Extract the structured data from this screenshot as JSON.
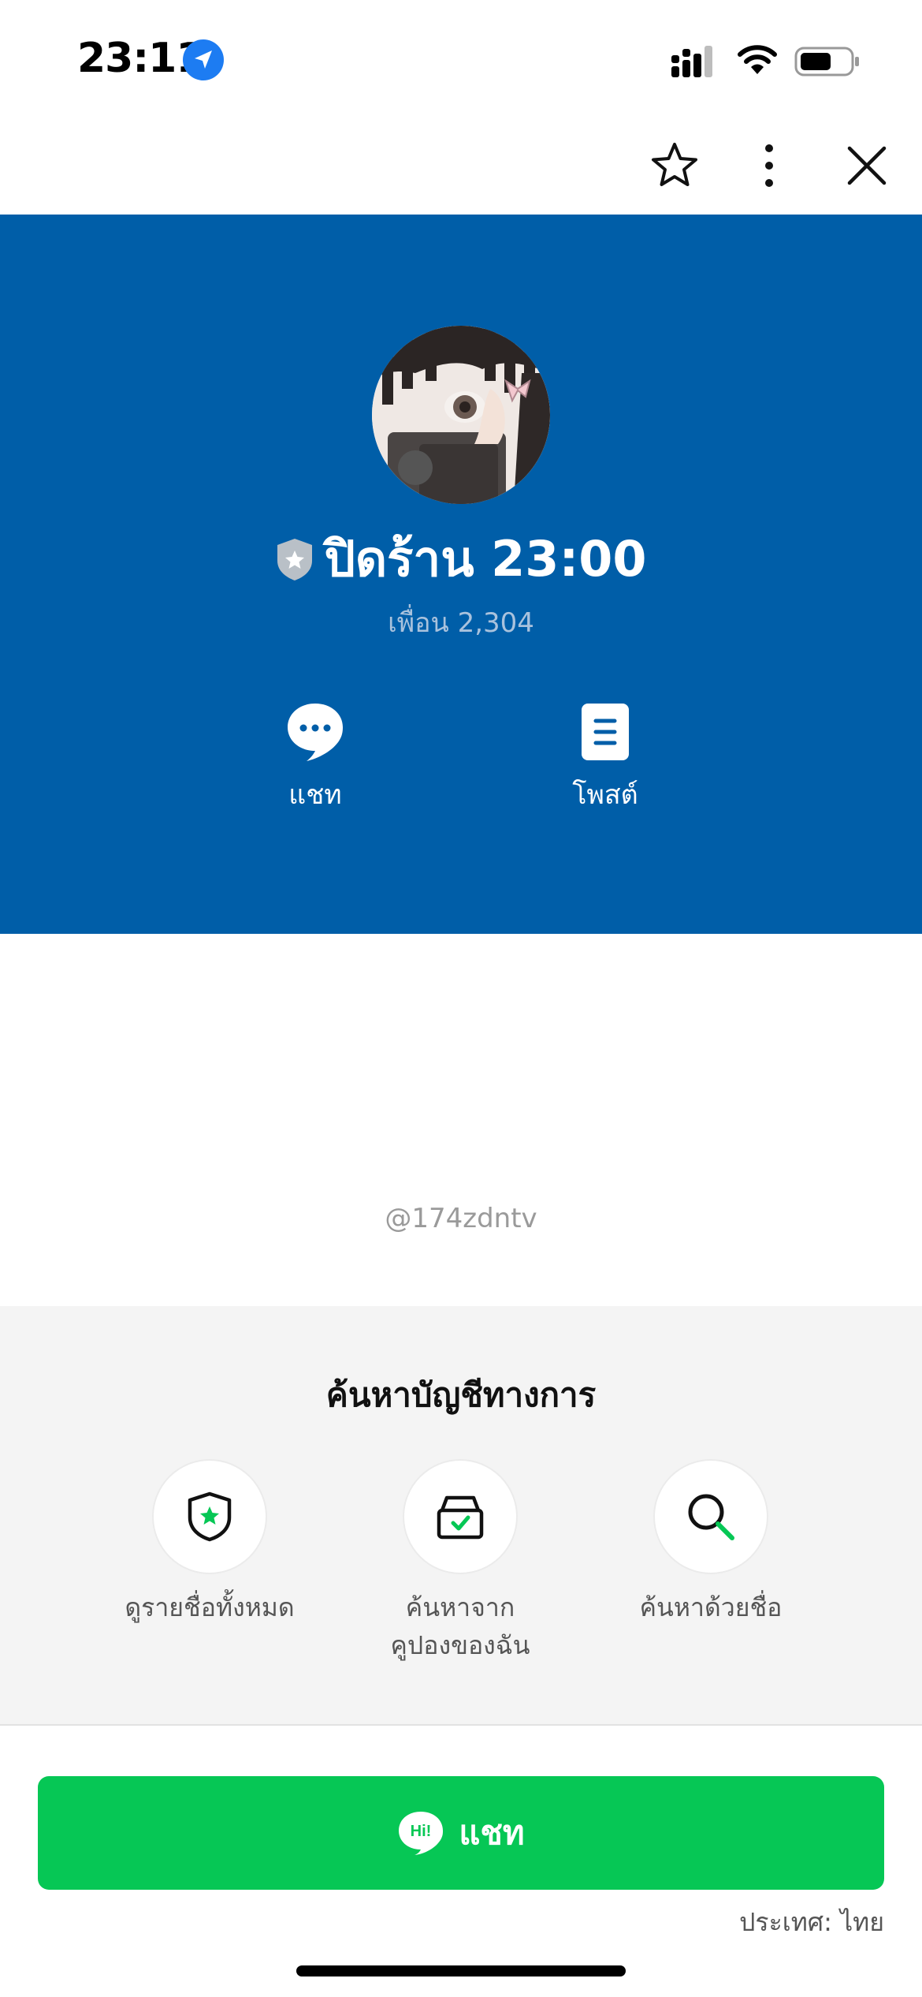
{
  "status_bar": {
    "time": "23:11",
    "icons": [
      "location-arrow-icon",
      "cellular-signal-icon",
      "wifi-icon",
      "battery-icon"
    ]
  },
  "top_bar": {
    "icons": [
      "star-icon",
      "more-vertical-icon",
      "close-icon"
    ]
  },
  "profile": {
    "name": "ปิดร้าน 23:00",
    "friends_text": "เพื่อน 2,304",
    "badge_icon": "shield-star-icon",
    "header_color": "#005ea8",
    "actions": [
      {
        "label": "แชท",
        "icon": "chat-bubble-icon"
      },
      {
        "label": "โพสต์",
        "icon": "post-document-icon"
      }
    ],
    "account_id": "@174zdntv"
  },
  "official_search": {
    "title": "ค้นหาบัญชีทางการ",
    "options": [
      {
        "label": "ดูรายชื่อทั้งหมด",
        "icon": "shield-star-icon"
      },
      {
        "label_line1": "ค้นหาจาก",
        "label_line2": "คูปองของฉัน",
        "icon": "coupon-box-icon"
      },
      {
        "label": "ค้นหาด้วยชื่อ",
        "icon": "search-icon"
      }
    ]
  },
  "bottom": {
    "chat_button_label": "แชท",
    "chat_button_color": "#06c755",
    "chat_button_icon": "hi-bubble-icon",
    "country": "ประเทศ: ไทย"
  }
}
